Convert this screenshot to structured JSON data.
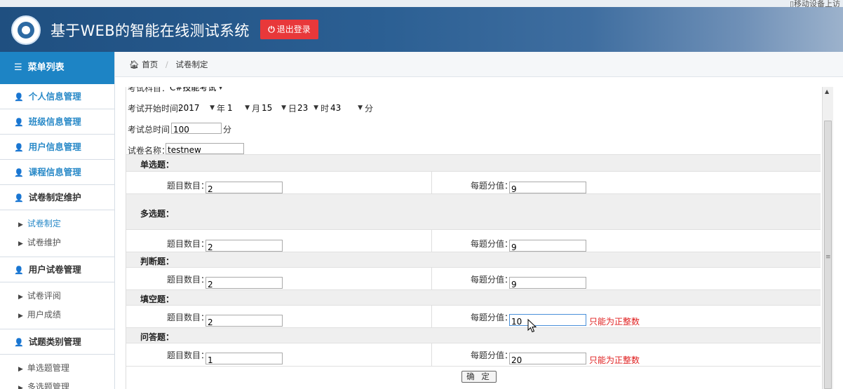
{
  "topbar": {
    "util_text": "▯移动设备上访"
  },
  "header": {
    "title": "基于WEB的智能在线测试系统",
    "logout_label": "退出登录",
    "logout_icon": "power-icon"
  },
  "sidebar": {
    "title": "菜单列表",
    "items": [
      {
        "label": "个人信息管理",
        "icon": "user-icon"
      },
      {
        "label": "班级信息管理",
        "icon": "user-icon"
      },
      {
        "label": "用户信息管理",
        "icon": "user-icon"
      },
      {
        "label": "课程信息管理",
        "icon": "user-icon"
      },
      {
        "label": "试卷制定维护",
        "icon": "user-icon",
        "subitems": [
          "试卷制定",
          "试卷维护"
        ],
        "active_sub": "试卷制定"
      },
      {
        "label": "用户试卷管理",
        "icon": "user-icon",
        "subitems": [
          "试卷评阅",
          "用户成绩"
        ]
      },
      {
        "label": "试题类别管理",
        "icon": "user-icon",
        "subitems": [
          "单选题管理",
          "多选题管理"
        ]
      }
    ]
  },
  "breadcrumb": {
    "home": "首页",
    "current": "试卷制定"
  },
  "form": {
    "subject_label": "考试科目：",
    "subject_value": "C#技能考试",
    "start_label": "考试开始时间:",
    "year": "2017",
    "year_unit": "年",
    "month": "1",
    "month_unit": "月",
    "day": "15",
    "day_unit": "日",
    "hour": "23",
    "hour_unit": "时",
    "minute": "43",
    "minute_unit": "分",
    "duration_label": "考试总时间：",
    "duration_value": "100",
    "duration_unit": "分",
    "name_label": "试卷名称：",
    "name_value": "testnew",
    "count_label": "题目数目：",
    "score_label": "每题分值：",
    "sections": [
      {
        "title": "单选题：",
        "count": "2",
        "score": "9",
        "error": ""
      },
      {
        "title": "多选题：",
        "count": "2",
        "score": "9",
        "error": ""
      },
      {
        "title": "判断题：",
        "count": "2",
        "score": "9",
        "error": ""
      },
      {
        "title": "填空题：",
        "count": "2",
        "score": "10",
        "error": "只能为正整数"
      },
      {
        "title": "问答题：",
        "count": "1",
        "score": "20",
        "error": "只能为正整数"
      }
    ],
    "confirm_label": "确 定"
  }
}
